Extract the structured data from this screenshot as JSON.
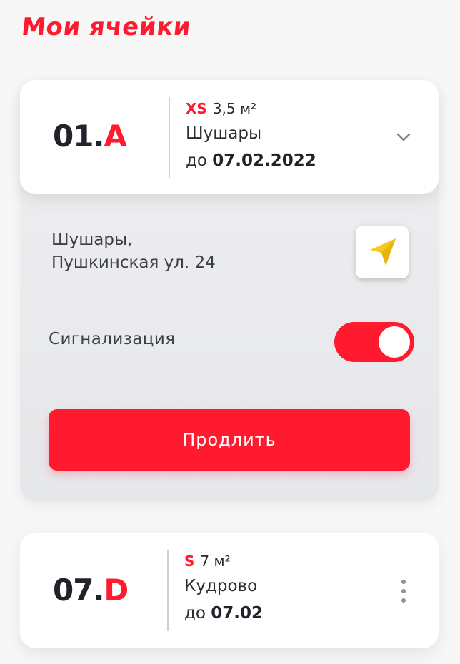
{
  "page": {
    "title": "Мои ячейки"
  },
  "cells": [
    {
      "code_number": "01",
      "code_dot": ".",
      "code_letter": "A",
      "size_class": "XS",
      "size_value": "3,5 м²",
      "location": "Шушары",
      "until_prefix": "до",
      "until_date": "07.02.2022",
      "address_line1": "Шушары,",
      "address_line2": "Пушкинская ул. 24",
      "alarm_label": "Сигнализация",
      "alarm_enabled": true,
      "extend_label": "Продлить",
      "expanded": true,
      "icons": {
        "expand": "chevron-down-icon",
        "navigate": "navigation-arrow-icon"
      }
    },
    {
      "code_number": "07",
      "code_dot": ".",
      "code_letter": "D",
      "size_class": "S",
      "size_value": "7 м²",
      "location": "Кудрово",
      "until_prefix": "до",
      "until_date": "07.02",
      "expanded": false,
      "icons": {
        "menu": "more-vertical-icon"
      }
    }
  ],
  "colors": {
    "accent": "#ff1a2f",
    "text_dark": "#20232a",
    "background": "#f7f7f7",
    "navigator_yellow": "#f7c21b"
  }
}
